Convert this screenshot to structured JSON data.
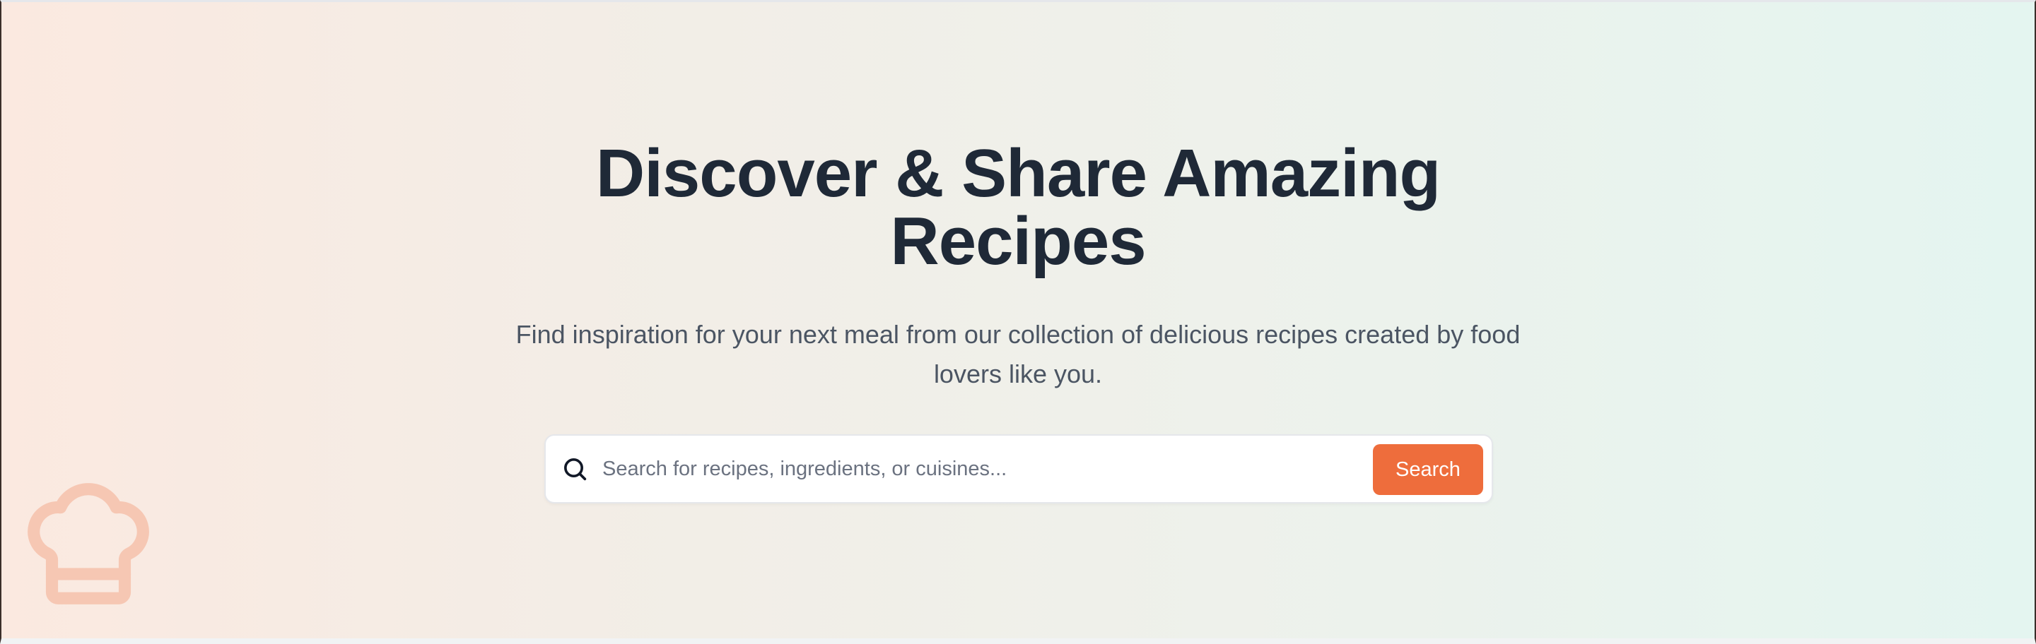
{
  "hero": {
    "title_line1": "Discover & Share Amazing",
    "title_line2": "Recipes",
    "subtitle": "Find inspiration for your next meal from our collection of delicious recipes created by food lovers like you."
  },
  "search": {
    "placeholder": "Search for recipes, ingredients, or cuisines...",
    "value": "",
    "button_label": "Search",
    "icon": "search-icon"
  },
  "decoration": {
    "icon": "chef-hat-icon",
    "color": "#f6c7b3"
  },
  "colors": {
    "accent": "#ee6d3c",
    "title": "#1f2937",
    "subtitle": "#4b5563",
    "gradient_start": "#fbe9e0",
    "gradient_end": "#e4f5f0"
  }
}
